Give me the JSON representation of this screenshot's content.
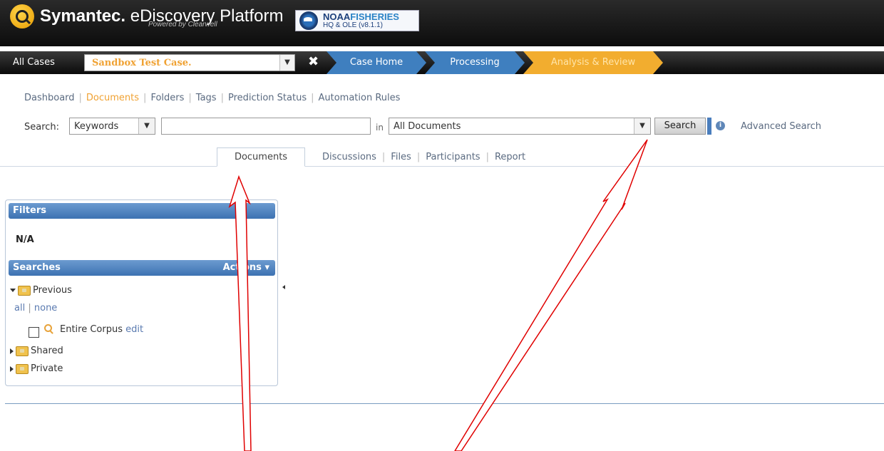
{
  "header": {
    "brand_bold": "Symantec.",
    "brand_name": " eDiscovery Platform",
    "brand_sub": "Powered by Clearwell",
    "noaa_line1": "NOAA",
    "noaa_line1b": "FISHERIES",
    "noaa_line2": "HQ & OLE (v8.1.1)",
    "colors": {
      "brand_accent": "#f2ad2f",
      "crumb_blue": "#3f7fbf"
    }
  },
  "navbar": {
    "all_cases": "All Cases",
    "case_selected": "Sandbox Test Case.",
    "close_symbol": "✖",
    "crumbs": [
      "Case Home",
      "Processing",
      "Analysis & Review"
    ]
  },
  "subnav": {
    "items": [
      "Dashboard",
      "Documents",
      "Folders",
      "Tags",
      "Prediction Status",
      "Automation Rules"
    ],
    "active": "Documents"
  },
  "search": {
    "label": "Search:",
    "type_selected": "Keywords",
    "query_value": "",
    "in_label": "in",
    "scope_selected": "All Documents",
    "button_label": "Search",
    "advanced_label": "Advanced Search",
    "help_icon": "info-icon"
  },
  "tabs": {
    "items": [
      "Documents",
      "Discussions",
      "Files",
      "Participants",
      "Report"
    ],
    "active": "Documents"
  },
  "panel": {
    "filters_title": "Filters",
    "filters_value": "N/A",
    "searches_title": "Searches",
    "actions_label": "Actions",
    "tree": {
      "previous": "Previous",
      "all": "all",
      "sep": "|",
      "none": "none",
      "entire_corpus": "Entire Corpus",
      "edit": "edit",
      "shared": "Shared",
      "private": "Private"
    }
  }
}
